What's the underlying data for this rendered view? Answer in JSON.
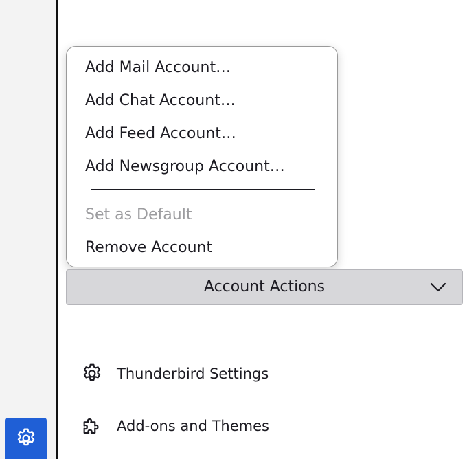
{
  "menu": {
    "items": [
      {
        "label": "Add Mail Account…",
        "enabled": true
      },
      {
        "label": "Add Chat Account…",
        "enabled": true
      },
      {
        "label": "Add Feed Account…",
        "enabled": true
      },
      {
        "label": "Add Newsgroup Account…",
        "enabled": true
      },
      {
        "label": "Set as Default",
        "enabled": false
      },
      {
        "label": "Remove Account",
        "enabled": true
      }
    ]
  },
  "account_actions": {
    "label": "Account Actions",
    "icon": "chevron-down-icon"
  },
  "bottom_links": [
    {
      "label": "Thunderbird Settings",
      "icon": "gear-icon"
    },
    {
      "label": "Add-ons and Themes",
      "icon": "puzzle-piece-icon"
    }
  ],
  "spaces_toolbar": {
    "settings_icon": "gear-icon",
    "accent_color": "#1f5fd6"
  }
}
